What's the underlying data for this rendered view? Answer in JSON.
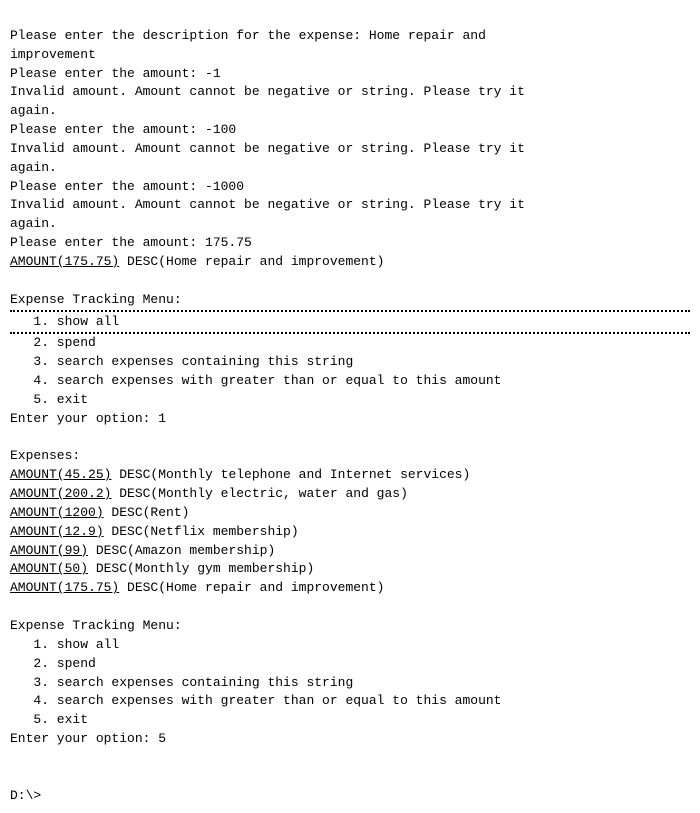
{
  "terminal": {
    "lines": [
      {
        "id": "l1",
        "type": "plain",
        "text": "Please enter the description for the expense: Home repair and"
      },
      {
        "id": "l2",
        "type": "plain",
        "text": "improvement"
      },
      {
        "id": "l3",
        "type": "plain",
        "text": "Please enter the amount: -1"
      },
      {
        "id": "l4",
        "type": "plain",
        "text": "Invalid amount. Amount cannot be negative or string. Please try it"
      },
      {
        "id": "l5",
        "type": "plain",
        "text": "again."
      },
      {
        "id": "l6",
        "type": "plain",
        "text": "Please enter the amount: -100"
      },
      {
        "id": "l7",
        "type": "plain",
        "text": "Invalid amount. Amount cannot be negative or string. Please try it"
      },
      {
        "id": "l8",
        "type": "plain",
        "text": "again."
      },
      {
        "id": "l9",
        "type": "plain",
        "text": "Please enter the amount: -1000"
      },
      {
        "id": "l10",
        "type": "plain",
        "text": "Invalid amount. Amount cannot be negative or string. Please try it"
      },
      {
        "id": "l11",
        "type": "plain",
        "text": "again."
      },
      {
        "id": "l12",
        "type": "plain",
        "text": "Please enter the amount: 175.75"
      },
      {
        "id": "l13",
        "type": "amount_desc",
        "amount": "AMOUNT(175.75)",
        "desc": " DESC(Home repair and improvement)"
      },
      {
        "id": "l14",
        "type": "blank"
      },
      {
        "id": "l15",
        "type": "plain",
        "text": "Expense Tracking Menu:"
      },
      {
        "id": "l16",
        "type": "dotted_menu_item",
        "text": "   1. show all"
      },
      {
        "id": "l17",
        "type": "plain",
        "text": "   2. spend"
      },
      {
        "id": "l18",
        "type": "plain",
        "text": "   3. search expenses containing this string"
      },
      {
        "id": "l19",
        "type": "plain",
        "text": "   4. search expenses with greater than or equal to this amount"
      },
      {
        "id": "l20",
        "type": "plain",
        "text": "   5. exit"
      },
      {
        "id": "l21",
        "type": "plain",
        "text": "Enter your option: 1"
      },
      {
        "id": "l22",
        "type": "blank"
      },
      {
        "id": "l23",
        "type": "plain",
        "text": "Expenses:"
      },
      {
        "id": "l24",
        "type": "amount_desc",
        "amount": "AMOUNT(45.25)",
        "desc": " DESC(Monthly telephone and Internet services)"
      },
      {
        "id": "l25",
        "type": "amount_desc",
        "amount": "AMOUNT(200.2)",
        "desc": " DESC(Monthly electric, water and gas)"
      },
      {
        "id": "l26",
        "type": "amount_desc",
        "amount": "AMOUNT(1200)",
        "desc": " DESC(Rent)"
      },
      {
        "id": "l27",
        "type": "amount_desc",
        "amount": "AMOUNT(12.9)",
        "desc": " DESC(Netflix membership)"
      },
      {
        "id": "l28",
        "type": "amount_desc",
        "amount": "AMOUNT(99)",
        "desc": " DESC(Amazon membership)"
      },
      {
        "id": "l29",
        "type": "amount_desc",
        "amount": "AMOUNT(50)",
        "desc": " DESC(Monthly gym membership)"
      },
      {
        "id": "l30",
        "type": "amount_desc",
        "amount": "AMOUNT(175.75)",
        "desc": " DESC(Home repair and improvement)"
      },
      {
        "id": "l31",
        "type": "blank"
      },
      {
        "id": "l32",
        "type": "plain",
        "text": "Expense Tracking Menu:"
      },
      {
        "id": "l33",
        "type": "plain",
        "text": "   1. show all"
      },
      {
        "id": "l34",
        "type": "plain",
        "text": "   2. spend"
      },
      {
        "id": "l35",
        "type": "plain",
        "text": "   3. search expenses containing this string"
      },
      {
        "id": "l36",
        "type": "plain",
        "text": "   4. search expenses with greater than or equal to this amount"
      },
      {
        "id": "l37",
        "type": "plain",
        "text": "   5. exit"
      },
      {
        "id": "l38",
        "type": "plain",
        "text": "Enter your option: 5"
      },
      {
        "id": "l39",
        "type": "blank"
      },
      {
        "id": "l40",
        "type": "blank"
      },
      {
        "id": "l41",
        "type": "plain",
        "text": "D:\\>"
      }
    ]
  }
}
